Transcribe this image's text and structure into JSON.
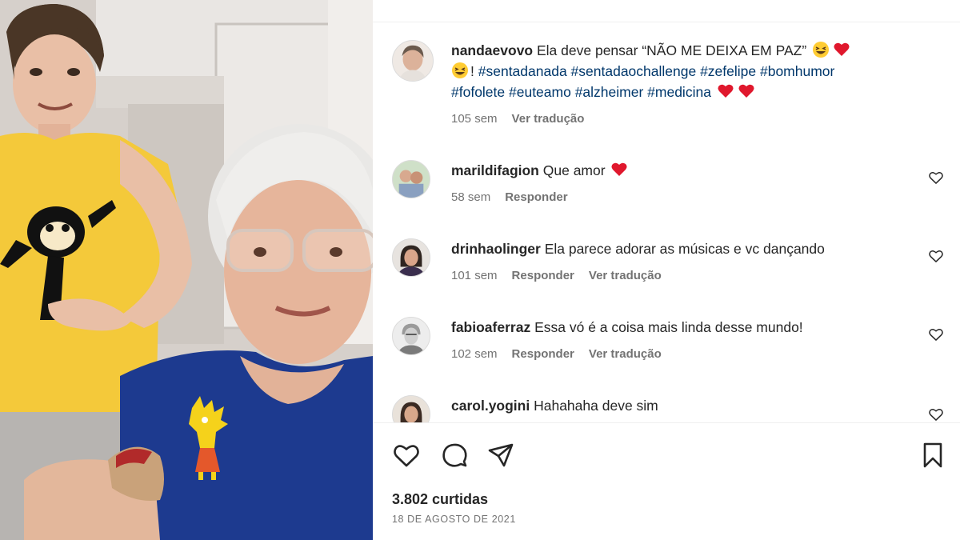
{
  "video": {
    "sticker_icon": "lisa-simpson-sticker",
    "shirt_icon": "felix-the-cat-print"
  },
  "post": {
    "caption": {
      "username": "nandaevovo",
      "text": "Ela deve pensar “NÃO ME DEIXA EM PAZ”",
      "exclamation": "!",
      "hashtags_line1": "#sentadanada #sentadaochallenge #zefelipe #bomhumor",
      "hashtags_line2": "#fofolete #euteamo #alzheimer #medicina",
      "time": "105 sem",
      "translate": "Ver tradução"
    },
    "comments": [
      {
        "username": "marildifagion",
        "text": "Que amor",
        "time": "58 sem",
        "reply": "Responder",
        "translate": ""
      },
      {
        "username": "drinhaolinger",
        "text": "Ela parece adorar as músicas e vc dançando",
        "time": "101 sem",
        "reply": "Responder",
        "translate": "Ver tradução"
      },
      {
        "username": "fabioaferraz",
        "text": "Essa vó é a coisa mais linda desse mundo!",
        "time": "102 sem",
        "reply": "Responder",
        "translate": "Ver tradução"
      },
      {
        "username": "carol.yogini",
        "text": "Hahahaha deve sim",
        "time": "",
        "reply": "",
        "translate": ""
      }
    ],
    "likes": "3.802 curtidas",
    "date": "18 DE AGOSTO DE 2021"
  },
  "icons": {
    "like": "heart-outline-icon",
    "comment": "comment-bubble-icon",
    "share": "paper-plane-icon",
    "save": "bookmark-icon"
  },
  "colors": {
    "text": "#262626",
    "muted": "#737373",
    "hashtag": "#00376b",
    "heart_emoji": "#e0182d",
    "shirt_yellow": "#f4c93a",
    "sweater_blue": "#1d3a8f"
  }
}
